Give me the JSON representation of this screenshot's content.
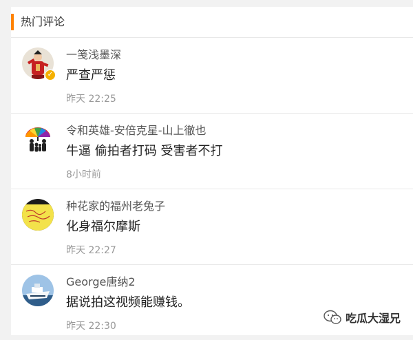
{
  "section": {
    "title": "热门评论",
    "accent_color": "#ff8200"
  },
  "comments": [
    {
      "username": "一笺浅墨深",
      "text": "严查严惩",
      "time": "昨天 22:25",
      "verified": true,
      "avatar_icon": "person-in-red-robe-avatar"
    },
    {
      "username": "令和英雄-安倍克星-山上徹也",
      "text": "牛逼 偷拍者打码 受害者不打",
      "time": "8小时前",
      "verified": false,
      "avatar_icon": "rainbow-umbrella-family-avatar"
    },
    {
      "username": "种花家的福州老兔子",
      "text": "化身福尔摩斯",
      "time": "昨天 22:27",
      "verified": false,
      "avatar_icon": "yellow-note-avatar"
    },
    {
      "username": "George唐纳2",
      "text": "据说拍这视频能赚钱。",
      "time": "昨天 22:30",
      "verified": false,
      "avatar_icon": "ship-avatar"
    }
  ],
  "watermark": {
    "text": "吃瓜大湿兄",
    "icon": "wechat-icon"
  }
}
